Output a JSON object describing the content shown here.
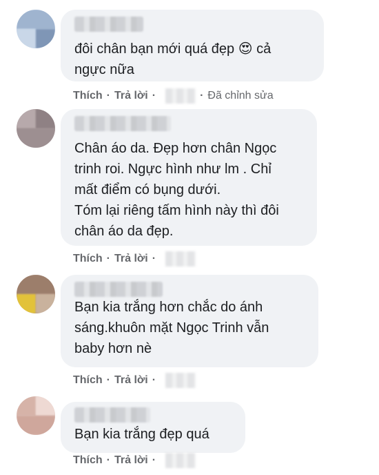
{
  "actions": {
    "like": "Thích",
    "reply": "Trả lời",
    "separator": "·",
    "edited": "Đã chỉnh sửa"
  },
  "comments": [
    {
      "text": "đôi chân bạn mới quá đẹp 😍 cả\nngực nữa"
    },
    {
      "text": "Chân áo da. Đẹp hơn chân Ngọc\ntrinh roi. Ngực hình như lm . Chỉ\nmất điểm có bụng dưới.\nTóm lại riêng tấm hình này thì đôi\nchân áo da đẹp."
    },
    {
      "text": "Bạn kia trắng hơn chắc do ánh\nsáng.khuôn mặt Ngọc Trinh vẫn\nbaby hơn nè"
    },
    {
      "text": "Bạn kia trắng đẹp quá"
    }
  ]
}
